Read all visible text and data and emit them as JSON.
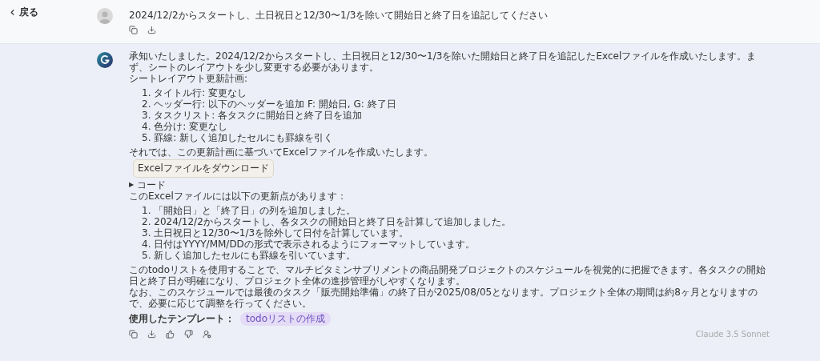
{
  "back": {
    "label": "戻る"
  },
  "user_message": {
    "text": "2024/12/2からスタートし、土日祝日と12/30〜1/3を除いて開始日と終了日を追記してください"
  },
  "reply": {
    "blocks": [
      {
        "kind": "text",
        "text": "承知いたしました。2024/12/2からスタートし、土日祝日と12/30〜1/3を除いた開始日と終了日を追記したExcelファイルを作成いたします。まず、シートのレイアウトを少し変更する必要があります。"
      },
      {
        "kind": "text",
        "text": "シートレイアウト更新計画:"
      },
      {
        "kind": "list",
        "items": [
          "1. タイトル行: 変更なし",
          "2. ヘッダー行: 以下のヘッダーを追加 F: 開始日, G: 終了日",
          "3. タスクリスト: 各タスクに開始日と終了日を追加",
          "4. 色分け: 変更なし",
          "5. 罫線: 新しく追加したセルにも罫線を引く"
        ]
      },
      {
        "kind": "text",
        "text": "それでは、この更新計画に基づいてExcelファイルを作成いたします。"
      },
      {
        "kind": "button",
        "text": "Excelファイルをダウンロード"
      },
      {
        "kind": "toggle",
        "arrow": "▶",
        "text": "コード",
        "expanded": false
      },
      {
        "kind": "text",
        "text": "このExcelファイルには以下の更新点があります："
      },
      {
        "kind": "list",
        "items": [
          "1. 「開始日」と「終了日」の列を追加しました。",
          "2. 2024/12/2からスタートし、各タスクの開始日と終了日を計算して追加しました。",
          "3. 土日祝日と12/30〜1/3を除外して日付を計算しています。",
          "4. 日付はYYYY/MM/DDの形式で表示されるようにフォーマットしています。",
          "5. 新しく追加したセルにも罫線を引いています。"
        ]
      },
      {
        "kind": "text",
        "text": "このtodoリストを使用することで、マルチビタミンサプリメントの商品開発プロジェクトのスケジュールを視覚的に把握できます。各タスクの開始日と終了日が明確になり、プロジェクト全体の進捗管理がしやすくなります。"
      },
      {
        "kind": "text",
        "text": "なお、このスケジュールでは最後のタスク「販売開始準備」の終了日が2025/08/05となります。プロジェクト全体の期間は約8ヶ月となりますので、必要に応じて調整を行ってください。"
      }
    ],
    "template_label": "使用したテンプレート：",
    "template_tag": "todoリストの作成",
    "model": "Claude 3.5 Sonnet"
  }
}
